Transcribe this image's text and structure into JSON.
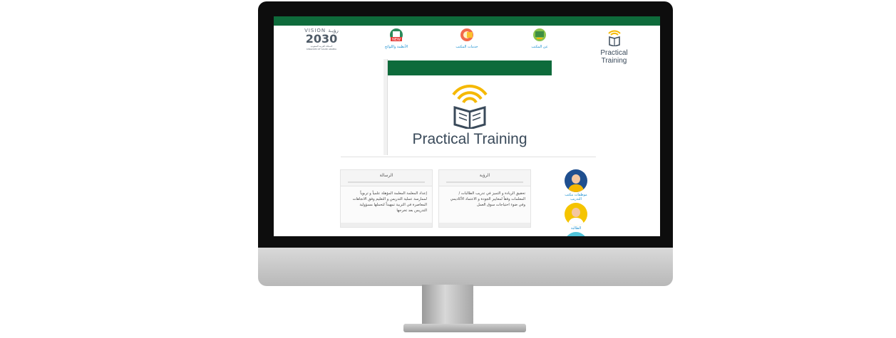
{
  "vision": {
    "line1": "VISION رؤيـة",
    "number": "2030",
    "line2": "المملكة العربية السعودية",
    "line3": "KINGDOM OF SAUDI ARABIA"
  },
  "nav": {
    "regulations": "الأنظمة واللوائح",
    "services": "خدمات المكتب",
    "about": "عن المكتب",
    "new_badge": "NEW"
  },
  "brand": {
    "logo_text": "Practical Training"
  },
  "hero": {
    "logo_text": "Practical Training"
  },
  "cards": {
    "vision": {
      "title": "الرؤية",
      "text": "تحقيق الريادة و التميز في تدريب الطالبات / المعلمات وفقاً لمعايير الجودة و الاعتماد الأكاديمي وفي ضوء احتياجات سوق العمل"
    },
    "mission": {
      "title": "الرسالة",
      "text": "إعداد المعلمة المعلمة المؤهلة علمياً و تربوياً لممارسة عملية التدريس و التعليم وفق الاتجاهات المعاصرة في التربية تمهيداً لتحملها مسؤولية التدريس بعد تخرجها"
    }
  },
  "side": {
    "staff_label": "موظفات مكتب التدريب",
    "student_label": "الطالبة"
  },
  "colors": {
    "green": "#0e6b3b",
    "link": "#1a8fd0",
    "gold": "#f5b800"
  }
}
